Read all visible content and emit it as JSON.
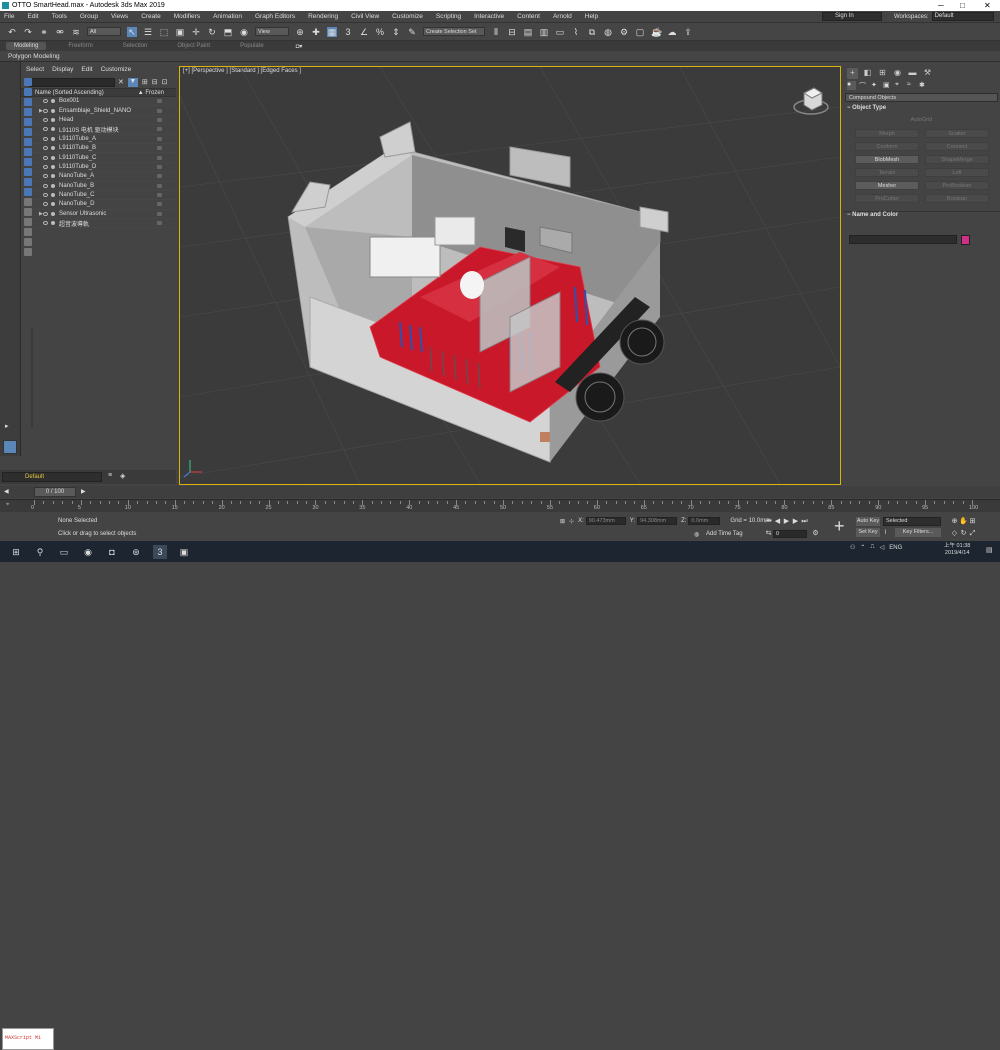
{
  "window": {
    "title": "OTTO SmartHead.max - Autodesk 3ds Max 2019",
    "minimize": "─",
    "maximize": "□",
    "close": "✕"
  },
  "menu": [
    "File",
    "Edit",
    "Tools",
    "Group",
    "Views",
    "Create",
    "Modifiers",
    "Animation",
    "Graph Editors",
    "Rendering",
    "Civil View",
    "Customize",
    "Scripting",
    "Interactive",
    "Content",
    "Arnold",
    "Help"
  ],
  "account": {
    "sign_in": "Sign In",
    "workspaces_label": "Workspaces:",
    "workspace": "Default"
  },
  "toolbar": {
    "filter": "All",
    "view": "View",
    "named_selection": "Create Selection Set"
  },
  "ribbon": {
    "tabs": [
      "Modeling",
      "Freeform",
      "Selection",
      "Object Paint",
      "Populate"
    ],
    "sub": "Polygon Modeling"
  },
  "scene_explorer": {
    "menu": [
      "Select",
      "Display",
      "Edit",
      "Customize"
    ],
    "col_name": "Name (Sorted Ascending)",
    "col_frozen": "▲ Frozen",
    "items": [
      {
        "name": "Box001",
        "expand": ""
      },
      {
        "name": "Ensamblaje_Shield_NANO",
        "expand": "▶"
      },
      {
        "name": "Head",
        "expand": ""
      },
      {
        "name": "L9110S 电机 驱动模块",
        "expand": ""
      },
      {
        "name": "L9110Tube_A",
        "expand": ""
      },
      {
        "name": "L9110Tube_B",
        "expand": ""
      },
      {
        "name": "L9110Tube_C",
        "expand": ""
      },
      {
        "name": "L9110Tube_D",
        "expand": ""
      },
      {
        "name": "NanoTube_A",
        "expand": ""
      },
      {
        "name": "NanoTube_B",
        "expand": ""
      },
      {
        "name": "NanoTube_C",
        "expand": ""
      },
      {
        "name": "NanoTube_D",
        "expand": ""
      },
      {
        "name": "Sensor Ultrasonic",
        "expand": "▶"
      },
      {
        "name": "超音波導軌",
        "expand": ""
      }
    ],
    "layer": "Default"
  },
  "viewport": {
    "label": "[+] [Perspective ] [Standard ] [Edged Faces ]"
  },
  "command_panel": {
    "dropdown": "Compound Objects",
    "object_type_title": "Object Type",
    "autogrid": "AutoGrid",
    "buttons": [
      "Morph",
      "Scatter",
      "Conform",
      "Connect",
      "BlobMesh",
      "ShapeMerge",
      "Terrain",
      "Loft",
      "Mesher",
      "ProBoolean",
      "ProCutter",
      "Boolean"
    ],
    "name_color_title": "Name and Color",
    "color": "#d12f86"
  },
  "time": {
    "slider": "0 / 100",
    "ticks": [
      "0",
      "5",
      "10",
      "15",
      "20",
      "25",
      "30",
      "35",
      "40",
      "45",
      "50",
      "55",
      "60",
      "65",
      "70",
      "75",
      "80",
      "85",
      "90",
      "95",
      "100"
    ]
  },
  "status": {
    "selected": "None Selected",
    "prompt": "Click or drag to select objects",
    "x_label": "X:",
    "x": "90.473mm",
    "y_label": "Y:",
    "y": "94.308mm",
    "z_label": "Z:",
    "z": "0.0mm",
    "grid": "Grid = 10.0mm",
    "add_time_tag": "Add Time Tag",
    "auto_key": "Auto Key",
    "key_mode": "Selected",
    "set_key": "Set Key",
    "key_filters": "Key Filters...",
    "frame": "0",
    "maxscript": "MAXScript Mi"
  },
  "taskbar": {
    "time": "上午 01:38",
    "date": "2019/4/14",
    "lang": "ENG"
  }
}
